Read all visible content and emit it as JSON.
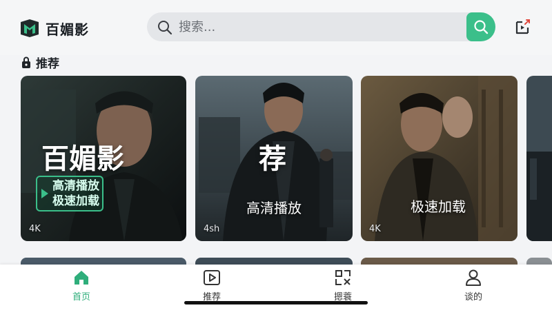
{
  "app": {
    "name": "百媚影"
  },
  "search": {
    "placeholder": "搜索..."
  },
  "section": {
    "title": "推荐"
  },
  "cards": [
    {
      "title": "百媚影",
      "badge_line1": "高清播放",
      "badge_line2": "极速加载",
      "quality": "4K"
    },
    {
      "title": "荐",
      "subtitle": "高清播放",
      "quality": "4sh"
    },
    {
      "title": "极速加载",
      "quality": "4K"
    }
  ],
  "tabbar": {
    "items": [
      {
        "label": "首页",
        "icon": "home-icon",
        "active": true
      },
      {
        "label": "推荐",
        "icon": "play-icon",
        "active": false
      },
      {
        "label": "摁蓑",
        "icon": "grid-icon",
        "active": false
      },
      {
        "label": "谈的",
        "icon": "user-icon",
        "active": false
      }
    ]
  },
  "colors": {
    "accent": "#3bbf8a",
    "background": "#f3f4f6"
  }
}
